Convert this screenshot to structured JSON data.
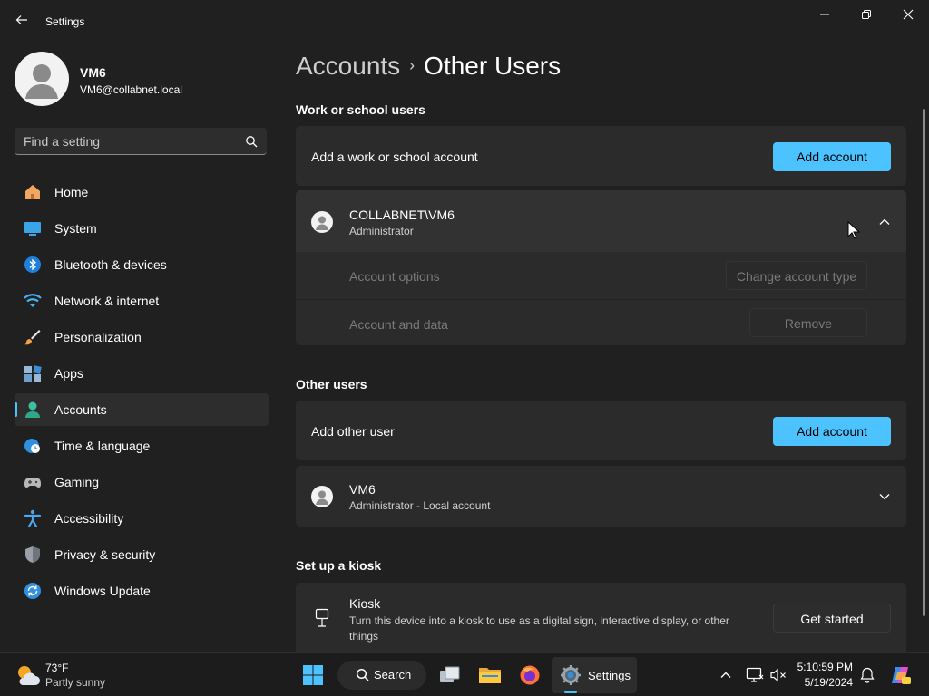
{
  "window": {
    "title": "Settings",
    "back_icon": "back-arrow-icon"
  },
  "profile": {
    "name": "VM6",
    "email": "VM6@collabnet.local"
  },
  "search": {
    "placeholder": "Find a setting"
  },
  "nav": {
    "items": [
      {
        "label": "Home",
        "icon": "home-icon"
      },
      {
        "label": "System",
        "icon": "system-icon"
      },
      {
        "label": "Bluetooth & devices",
        "icon": "bluetooth-icon"
      },
      {
        "label": "Network & internet",
        "icon": "wifi-icon"
      },
      {
        "label": "Personalization",
        "icon": "brush-icon"
      },
      {
        "label": "Apps",
        "icon": "apps-icon"
      },
      {
        "label": "Accounts",
        "icon": "accounts-icon",
        "active": true
      },
      {
        "label": "Time & language",
        "icon": "clock-globe-icon"
      },
      {
        "label": "Gaming",
        "icon": "gamepad-icon"
      },
      {
        "label": "Accessibility",
        "icon": "accessibility-icon"
      },
      {
        "label": "Privacy & security",
        "icon": "shield-icon"
      },
      {
        "label": "Windows Update",
        "icon": "update-icon"
      }
    ]
  },
  "breadcrumb": {
    "parent": "Accounts",
    "separator": "›",
    "current": "Other Users"
  },
  "work_school": {
    "heading": "Work or school users",
    "add_label": "Add a work or school account",
    "add_button": "Add account",
    "account": {
      "name": "COLLABNET\\VM6",
      "role": "Administrator",
      "expanded": true,
      "options_label": "Account options",
      "options_button": "Change account type",
      "data_label": "Account and data",
      "data_button": "Remove"
    }
  },
  "other_users": {
    "heading": "Other users",
    "add_label": "Add other user",
    "add_button": "Add account",
    "account": {
      "name": "VM6",
      "role": "Administrator - Local account",
      "expanded": false
    }
  },
  "kiosk": {
    "heading": "Set up a kiosk",
    "title": "Kiosk",
    "description": "Turn this device into a kiosk to use as a digital sign, interactive display, or other things",
    "button": "Get started"
  },
  "taskbar": {
    "weather_temp": "73°F",
    "weather_desc": "Partly sunny",
    "search_label": "Search",
    "active_app_label": "Settings",
    "time": "5:10:59 PM",
    "date": "5/19/2024"
  },
  "colors": {
    "accent": "#4cc2ff",
    "background": "#202020",
    "card": "#2b2b2b"
  }
}
